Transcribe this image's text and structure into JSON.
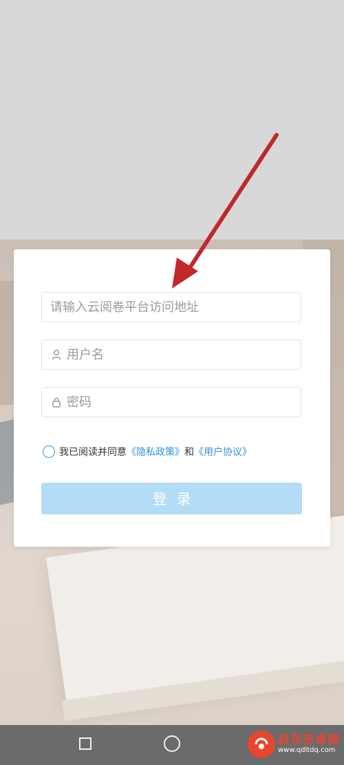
{
  "form": {
    "url_placeholder": "请输入云阅卷平台访问地址",
    "username_placeholder": "用户名",
    "password_placeholder": "密码",
    "agreement": {
      "prefix": "我已阅读并同意",
      "privacy_link": "《隐私政策》",
      "conjunction": "和",
      "terms_link": "《用户协议》"
    },
    "login_label": "登录"
  },
  "watermark": {
    "title": "启东安卓网",
    "url": "www.qdltdq.com"
  },
  "colors": {
    "accent": "#2d93e0",
    "login_button": "#b3dcf7",
    "arrow": "#c0282a",
    "navbar": "#6b6b6b"
  },
  "icons": {
    "username": "user-icon",
    "password": "lock-icon",
    "nav_recent": "square-icon",
    "nav_home": "circle-icon"
  }
}
